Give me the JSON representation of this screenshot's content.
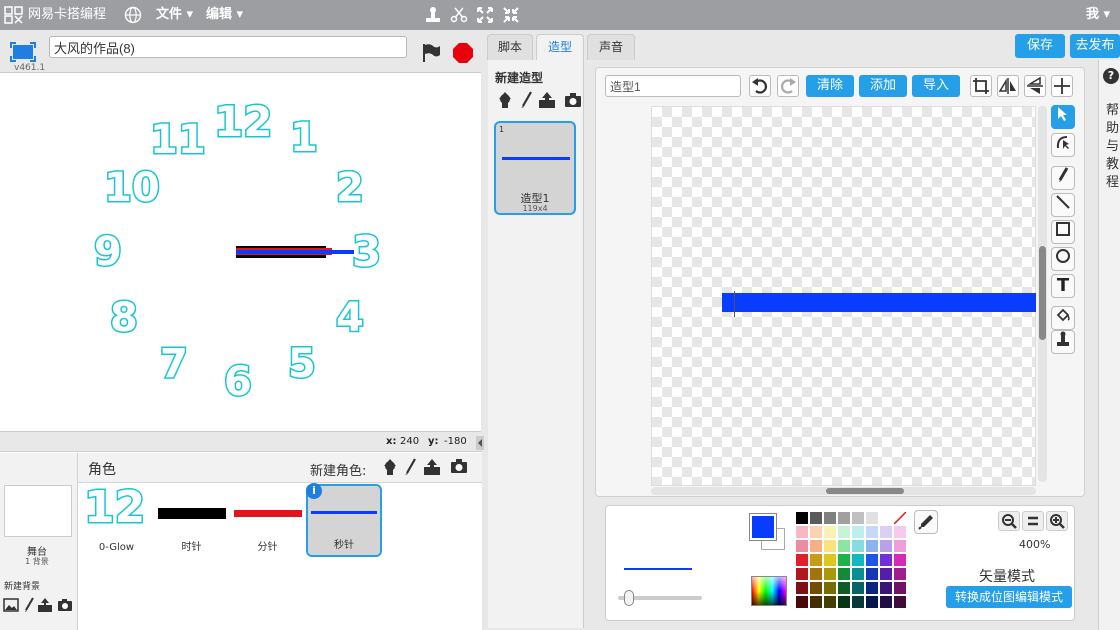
{
  "topbar": {
    "site_name": "网易卡搭编程",
    "menu_file": "文件",
    "menu_edit": "编辑",
    "user": "我"
  },
  "stage_header": {
    "version": "v461.1",
    "project_name": "大风的作品(8)"
  },
  "stage": {
    "clock_numbers": [
      "12",
      "1",
      "2",
      "3",
      "4",
      "5",
      "6",
      "7",
      "8",
      "9",
      "10",
      "11"
    ],
    "coord_x_label": "x:",
    "coord_x": "240",
    "coord_y_label": "y:",
    "coord_y": "-180"
  },
  "sprites": {
    "header_label": "角色",
    "new_sprite_label": "新建角色:",
    "stage_label": "舞台",
    "stage_bg_count": "1 背景",
    "new_backdrop_label": "新建背景",
    "items": [
      {
        "name": "0-Glow",
        "preview": "12"
      },
      {
        "name": "时针"
      },
      {
        "name": "分针"
      },
      {
        "name": "秒针"
      }
    ]
  },
  "editor": {
    "tabs": [
      "脚本",
      "造型",
      "声音"
    ],
    "active_tab": "造型",
    "save_button": "保存",
    "publish_button": "去发布",
    "new_costume_label": "新建造型",
    "costumes": [
      {
        "index": "1",
        "name": "造型1",
        "size": "119x4"
      }
    ],
    "costume_name_value": "造型1",
    "clear_button": "清除",
    "add_button": "添加",
    "import_button": "导入",
    "zoom_level": "400%",
    "mode_label": "矢量模式",
    "convert_button": "转换成位图编辑模式",
    "help_text": "帮助与教程"
  },
  "colors": {
    "accent_blue": "#25a0e8",
    "clock_number": "#18c6cf",
    "second_hand": "#0a3cff",
    "minute_hand": "#e0161c",
    "hour_hand": "#000000",
    "selected_fill": "#0a3cff"
  },
  "palette": [
    [
      "#000000",
      "#5a5a5a",
      "#808080",
      "#a0a0a0",
      "#c0c0c0",
      "#e0e0e0",
      "#ffffff",
      "transparent"
    ],
    [
      "#f7b8c4",
      "#fbd2b2",
      "#fcf2b6",
      "#c8f3d6",
      "#bfeef0",
      "#c7d8f6",
      "#dbcff3",
      "#f6c9ee"
    ],
    [
      "#f08aa4",
      "#f7b083",
      "#f7e47c",
      "#8ce5a3",
      "#84dde3",
      "#8cb2ef",
      "#b7a1ea",
      "#ef9ddd"
    ],
    [
      "#e21e2a",
      "#c79b16",
      "#dac91a",
      "#1eb34a",
      "#10b9c0",
      "#1d55e6",
      "#7130d8",
      "#d62ab6"
    ],
    [
      "#b0171f",
      "#a4720c",
      "#a69a0a",
      "#148a38",
      "#0a8f94",
      "#1338b4",
      "#531ea8",
      "#a11f8d"
    ],
    [
      "#7e0f14",
      "#734d06",
      "#776d05",
      "#0c5e25",
      "#066367",
      "#0b2580",
      "#3a1576",
      "#6f1462"
    ],
    [
      "#4a080b",
      "#442d03",
      "#444002",
      "#063616",
      "#043a3c",
      "#07164c",
      "#220c46",
      "#410b3a"
    ]
  ]
}
